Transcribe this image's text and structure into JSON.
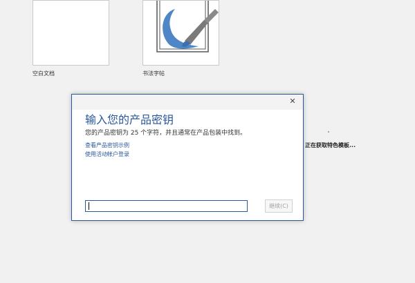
{
  "templates": [
    {
      "label": "空白文档",
      "icon": "blank-document-icon"
    },
    {
      "label": "书法字帖",
      "icon": "calligraphy-brush-icon"
    }
  ],
  "loading": {
    "text": "正在获取特色模板..."
  },
  "dialog": {
    "title": "输入您的产品密钥",
    "description": "您的产品密钥为 25 个字符，并且通常在产品包装中找到。",
    "links": [
      "查看产品密钥示例",
      "使用活动帐户登录"
    ],
    "key_input_value": "",
    "continue_label": "继续(C)",
    "close_glyph": "✕"
  },
  "colors": {
    "accent": "#2b579a",
    "background": "#f1f1f1"
  }
}
